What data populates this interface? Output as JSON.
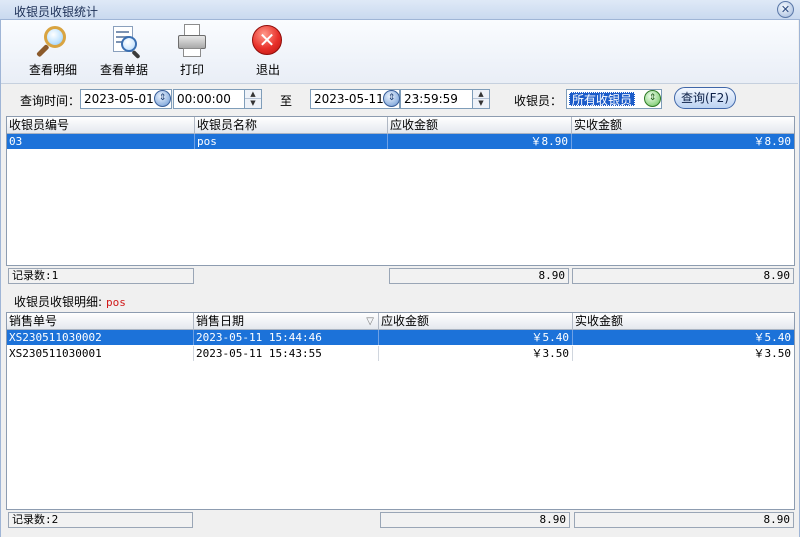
{
  "window": {
    "title": "收银员收银统计",
    "close_icon": "close-icon"
  },
  "toolbar": {
    "buttons": [
      {
        "label": "查看明细",
        "icon": "magnifier-icon"
      },
      {
        "label": "查看单据",
        "icon": "document-search-icon"
      },
      {
        "label": "打印",
        "icon": "printer-icon"
      },
      {
        "label": "退出",
        "icon": "exit-icon"
      }
    ]
  },
  "query": {
    "time_label": "查询时间：",
    "start_date": "2023-05-01",
    "start_time": "00:00:00",
    "to_label": "至",
    "end_date": "2023-05-11",
    "end_time": "23:59:59",
    "cashier_label": "收银员：",
    "cashier_value": "所有收银员",
    "query_button": "查询(F2)"
  },
  "summary_table": {
    "columns": [
      "收银员编号",
      "收银员名称",
      "应收金额",
      "实收金额"
    ],
    "rows": [
      {
        "code": "03",
        "name": "pos",
        "receivable": "￥8.90",
        "received": "￥8.90",
        "selected": true
      }
    ],
    "footer": {
      "count": "记录数:1",
      "receivable_total": "8.90",
      "received_total": "8.90"
    }
  },
  "detail": {
    "label": "收银员收银明细:",
    "cashier": "pos"
  },
  "detail_table": {
    "columns": [
      "销售单号",
      "销售日期",
      "应收金额",
      "实收金额"
    ],
    "sort_icon": "sort-descending-icon",
    "rows": [
      {
        "order_no": "XS230511030002",
        "date": "2023-05-11 15:44:46",
        "receivable": "￥5.40",
        "received": "￥5.40",
        "selected": true
      },
      {
        "order_no": "XS230511030001",
        "date": "2023-05-11 15:43:55",
        "receivable": "￥3.50",
        "received": "￥3.50",
        "selected": false
      }
    ],
    "footer": {
      "count": "记录数:2",
      "receivable_total": "8.90",
      "received_total": "8.90"
    }
  },
  "colors": {
    "selection": "#1c72d9",
    "title_bar": "#c9d9ef",
    "detail_name": "#d01818"
  }
}
